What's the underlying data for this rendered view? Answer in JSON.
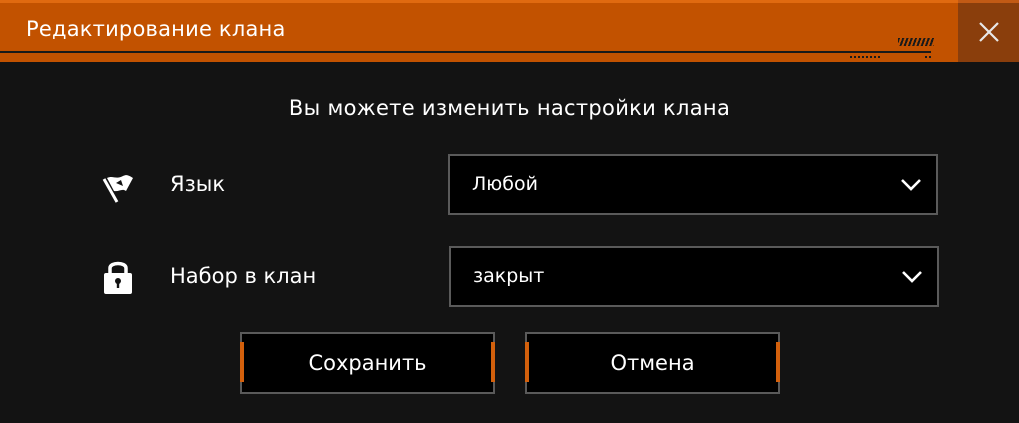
{
  "dialog": {
    "title": "Редактирование клана",
    "subtitle": "Вы можете изменить настройки клана",
    "close_icon": "close-icon"
  },
  "settings": [
    {
      "icon": "flag-icon",
      "label": "Язык",
      "value": "Любой"
    },
    {
      "icon": "lock-icon",
      "label": "Набор в клан",
      "value": "закрыт"
    }
  ],
  "buttons": {
    "save": "Сохранить",
    "cancel": "Отмена"
  },
  "colors": {
    "accent": "#c25200",
    "close_bg": "#8a3e0c",
    "background": "#131313",
    "field_border": "#5a5a5a"
  }
}
